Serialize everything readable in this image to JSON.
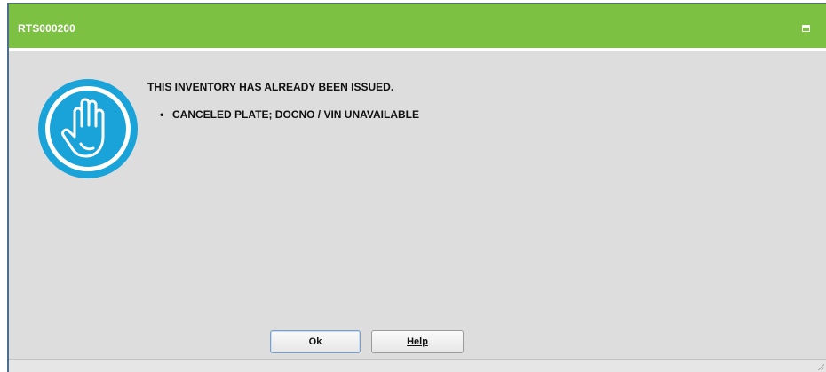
{
  "window": {
    "title": "RTS000200",
    "titlebar_color": "#7dc143",
    "icon": "stop-hand-icon",
    "icon_color": "#1aa3d9"
  },
  "message": {
    "heading": "THIS INVENTORY HAS ALREADY BEEN ISSUED.",
    "details": [
      "CANCELED PLATE; DOCNO / VIN UNAVAILABLE"
    ]
  },
  "buttons": {
    "ok_label": "Ok",
    "help_label": "Help"
  }
}
